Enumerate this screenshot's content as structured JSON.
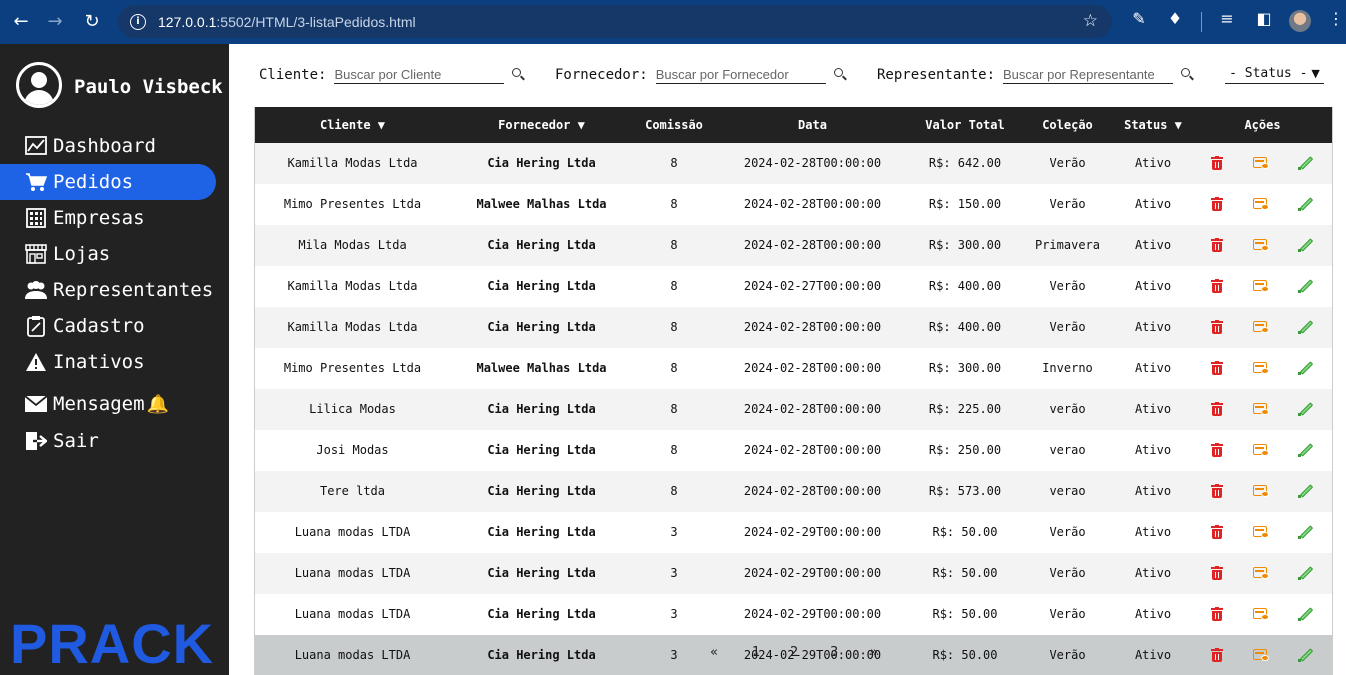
{
  "browser": {
    "url_host": "127.0.0.1",
    "url_path": ":5502/HTML/3-listaPedidos.html"
  },
  "sidebar": {
    "user_name": "Paulo Visbeck",
    "items": [
      {
        "label": "Dashboard",
        "icon": "chart-icon"
      },
      {
        "label": "Pedidos",
        "icon": "cart-icon",
        "active": true
      },
      {
        "label": "Empresas",
        "icon": "building-icon"
      },
      {
        "label": "Lojas",
        "icon": "store-icon"
      },
      {
        "label": "Representantes",
        "icon": "users-icon"
      },
      {
        "label": "Cadastro",
        "icon": "clipboard-icon"
      },
      {
        "label": "Inativos",
        "icon": "warning-icon"
      },
      {
        "label": "Mensagem",
        "icon": "envelope-icon"
      },
      {
        "label": "Sair",
        "icon": "logout-icon"
      }
    ],
    "brand": "PRACK"
  },
  "filters": {
    "cliente_label": "Cliente:",
    "cliente_placeholder": "Buscar por Cliente",
    "fornecedor_label": "Fornecedor:",
    "fornecedor_placeholder": "Buscar por Fornecedor",
    "representante_label": "Representante:",
    "representante_placeholder": "Buscar por Representante",
    "status_value": "- Status -"
  },
  "table": {
    "headers": {
      "cliente": "Cliente ▼",
      "fornecedor": "Fornecedor ▼",
      "comissao": "Comissão",
      "data": "Data",
      "valor": "Valor Total",
      "colecao": "Coleção",
      "status": "Status ▼",
      "acoes": "Ações"
    },
    "rows": [
      {
        "cliente": "Kamilla Modas Ltda",
        "fornecedor": "Cia Hering Ltda",
        "comissao": "8",
        "data": "2024-02-28T00:00:00",
        "valor": "R$: 642.00",
        "colecao": "Verão",
        "status": "Ativo"
      },
      {
        "cliente": "Mimo Presentes Ltda",
        "fornecedor": "Malwee Malhas Ltda",
        "comissao": "8",
        "data": "2024-02-28T00:00:00",
        "valor": "R$: 150.00",
        "colecao": "Verão",
        "status": "Ativo"
      },
      {
        "cliente": "Mila Modas Ltda",
        "fornecedor": "Cia Hering Ltda",
        "comissao": "8",
        "data": "2024-02-28T00:00:00",
        "valor": "R$: 300.00",
        "colecao": "Primavera",
        "status": "Ativo"
      },
      {
        "cliente": "Kamilla Modas Ltda",
        "fornecedor": "Cia Hering Ltda",
        "comissao": "8",
        "data": "2024-02-27T00:00:00",
        "valor": "R$: 400.00",
        "colecao": "Verão",
        "status": "Ativo"
      },
      {
        "cliente": "Kamilla Modas Ltda",
        "fornecedor": "Cia Hering Ltda",
        "comissao": "8",
        "data": "2024-02-28T00:00:00",
        "valor": "R$: 400.00",
        "colecao": "Verão",
        "status": "Ativo"
      },
      {
        "cliente": "Mimo Presentes Ltda",
        "fornecedor": "Malwee Malhas Ltda",
        "comissao": "8",
        "data": "2024-02-28T00:00:00",
        "valor": "R$: 300.00",
        "colecao": "Inverno",
        "status": "Ativo"
      },
      {
        "cliente": "Lilica Modas",
        "fornecedor": "Cia Hering Ltda",
        "comissao": "8",
        "data": "2024-02-28T00:00:00",
        "valor": "R$: 225.00",
        "colecao": "verão",
        "status": "Ativo"
      },
      {
        "cliente": "Josi Modas",
        "fornecedor": "Cia Hering Ltda",
        "comissao": "8",
        "data": "2024-02-28T00:00:00",
        "valor": "R$: 250.00",
        "colecao": "verao",
        "status": "Ativo"
      },
      {
        "cliente": "Tere ltda",
        "fornecedor": "Cia Hering Ltda",
        "comissao": "8",
        "data": "2024-02-28T00:00:00",
        "valor": "R$: 573.00",
        "colecao": "verao",
        "status": "Ativo"
      },
      {
        "cliente": "Luana modas LTDA",
        "fornecedor": "Cia Hering Ltda",
        "comissao": "3",
        "data": "2024-02-29T00:00:00",
        "valor": "R$: 50.00",
        "colecao": "Verão",
        "status": "Ativo"
      },
      {
        "cliente": "Luana modas LTDA",
        "fornecedor": "Cia Hering Ltda",
        "comissao": "3",
        "data": "2024-02-29T00:00:00",
        "valor": "R$: 50.00",
        "colecao": "Verão",
        "status": "Ativo"
      },
      {
        "cliente": "Luana modas LTDA",
        "fornecedor": "Cia Hering Ltda",
        "comissao": "3",
        "data": "2024-02-29T00:00:00",
        "valor": "R$: 50.00",
        "colecao": "Verão",
        "status": "Ativo"
      },
      {
        "cliente": "Luana modas LTDA",
        "fornecedor": "Cia Hering Ltda",
        "comissao": "3",
        "data": "2024-02-29T00:00:00",
        "valor": "R$: 50.00",
        "colecao": "Verão",
        "status": "Ativo"
      }
    ]
  },
  "pagination": {
    "prev": "«",
    "pages": [
      "1",
      "2",
      "3"
    ],
    "next": "»"
  },
  "colors": {
    "sidebar_bg": "#222222",
    "active_item": "#1e63e6",
    "brand": "#1f5ae0",
    "delete": "#e02424",
    "view": "#f08a00",
    "edit": "#3a9a3a"
  }
}
